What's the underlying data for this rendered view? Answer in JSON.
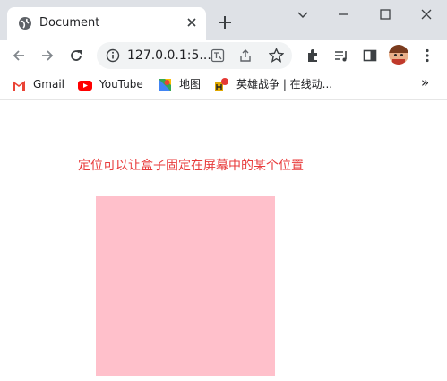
{
  "browser": {
    "tab_title": "Document",
    "url": "127.0.0.1:5...",
    "bookmarks": [
      {
        "label": "Gmail"
      },
      {
        "label": "YouTube"
      },
      {
        "label": "地图"
      },
      {
        "label": "英雄战争 | 在线动..."
      }
    ],
    "more_bookmarks": "»"
  },
  "page": {
    "headline": "定位可以让盒子固定在屏幕中的某个位置",
    "box_color": "#ffc0cb"
  }
}
